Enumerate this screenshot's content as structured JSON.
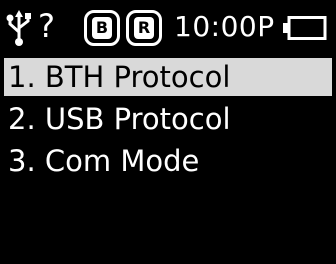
{
  "status_bar": {
    "usb_icon": "usb-icon",
    "unknown_icon": "?",
    "badge_b": "B",
    "badge_r": "R",
    "time": "10:00P",
    "battery_icon": "battery-icon"
  },
  "menu": {
    "items": [
      {
        "label": "1. BTH Protocol",
        "selected": true
      },
      {
        "label": "2. USB Protocol",
        "selected": false
      },
      {
        "label": "3. Com Mode",
        "selected": false
      }
    ]
  },
  "colors": {
    "background": "#000000",
    "foreground": "#ffffff",
    "selection": "#d9d9d9"
  }
}
